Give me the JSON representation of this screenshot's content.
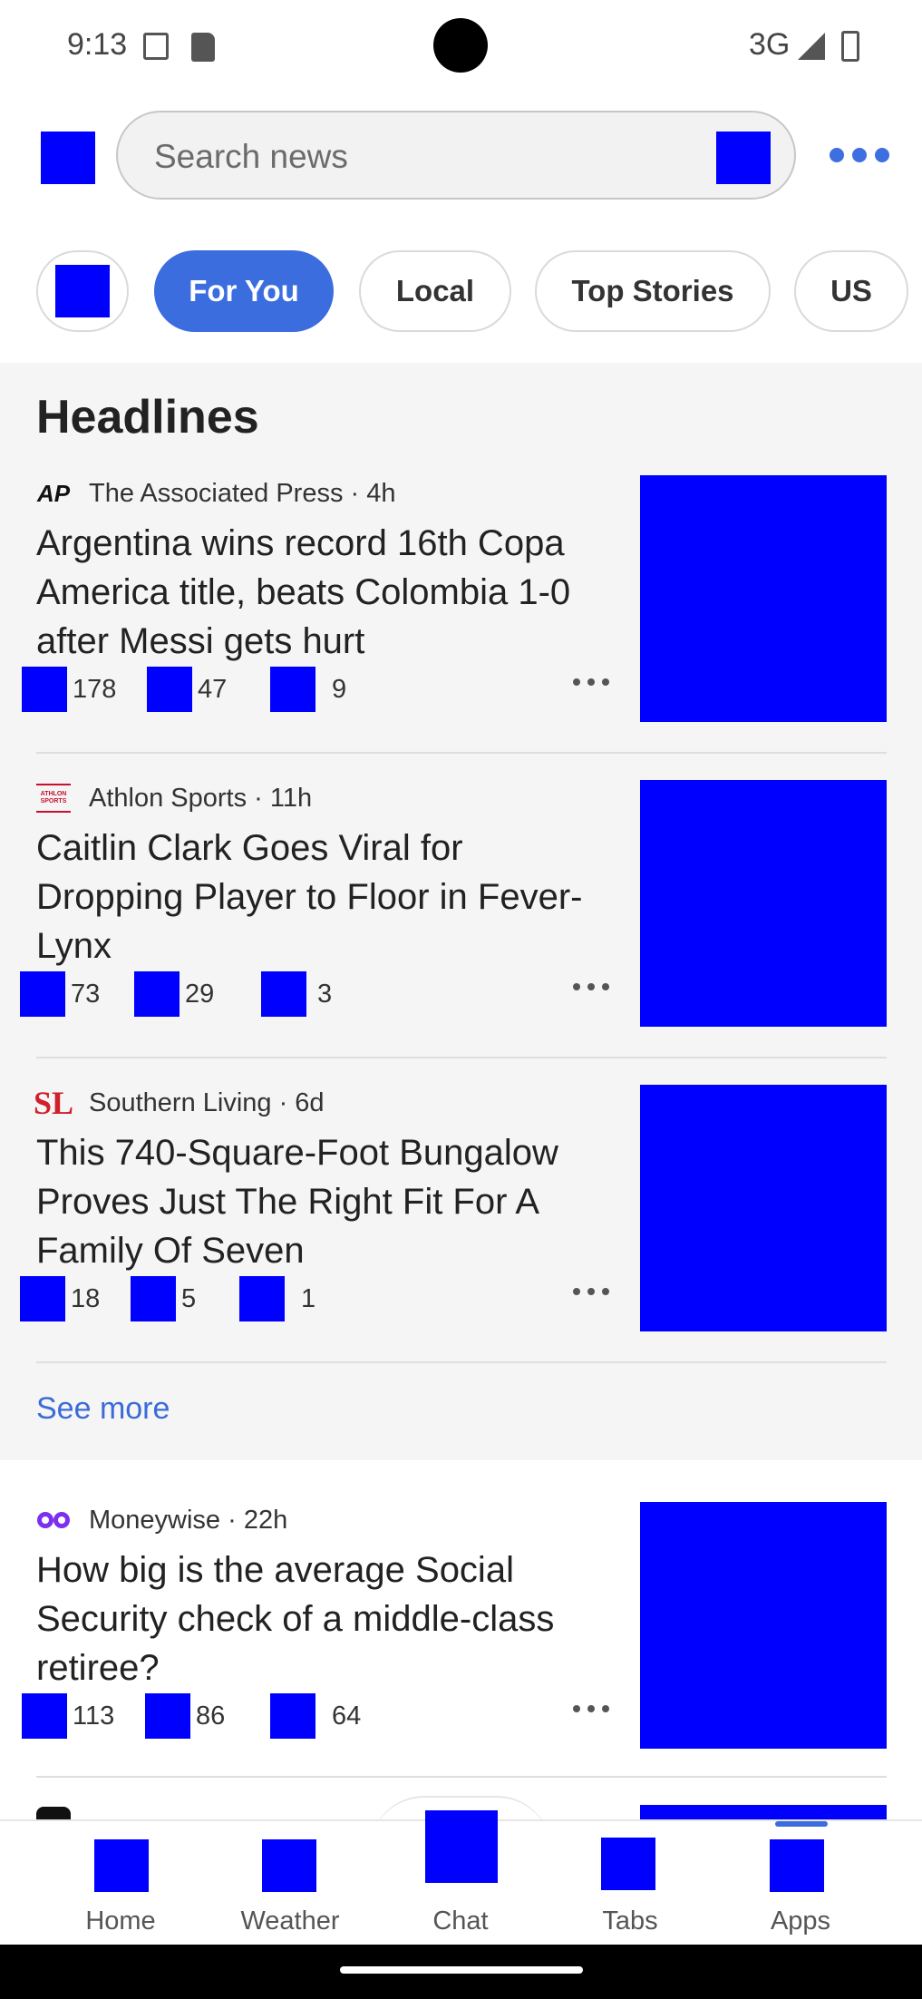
{
  "status_bar": {
    "time": "9:13",
    "network": "3G"
  },
  "search": {
    "placeholder": "Search news"
  },
  "tabs": [
    {
      "label": "For You",
      "active": true
    },
    {
      "label": "Local",
      "active": false
    },
    {
      "label": "Top Stories",
      "active": false
    },
    {
      "label": "US",
      "active": false
    }
  ],
  "headlines": {
    "title": "Headlines",
    "articles": [
      {
        "source": "The Associated Press · 4h",
        "logo_text": "AP",
        "title": "Argentina wins record 16th Copa America title, beats Colombia 1-0 after Messi gets hurt",
        "likes": "178",
        "dislikes": "47",
        "comments": "9"
      },
      {
        "source": "Athlon Sports · 11h",
        "logo_text": "ATHLON SPORTS",
        "title": "Caitlin Clark Goes Viral for Dropping Player to Floor in Fever-Lynx",
        "likes": "73",
        "dislikes": "29",
        "comments": "3"
      },
      {
        "source": "Southern Living · 6d",
        "logo_text": "SL",
        "title": "This 740-Square-Foot Bungalow Proves Just The Right Fit For A Family Of Seven",
        "likes": "18",
        "dislikes": "5",
        "comments": "1"
      }
    ],
    "see_more": "See more"
  },
  "feed": [
    {
      "source": "Moneywise · 22h",
      "title": "How big is the average Social Security check of a middle-class retiree?",
      "likes": "113",
      "dislikes": "86",
      "comments": "64"
    }
  ],
  "bottom_nav": [
    {
      "label": "Home"
    },
    {
      "label": "Weather"
    },
    {
      "label": "Chat"
    },
    {
      "label": "Tabs"
    },
    {
      "label": "Apps",
      "active": true
    }
  ],
  "colors": {
    "accent": "#3c6ddf",
    "placeholder_block": "#0000ff",
    "link": "#3a6bd9"
  }
}
